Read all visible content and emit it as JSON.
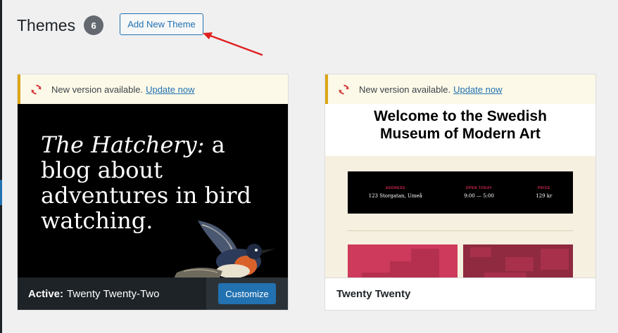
{
  "header": {
    "title": "Themes",
    "count": "6",
    "add_button": "Add New Theme"
  },
  "themes": [
    {
      "notice_text": "New version available.",
      "notice_link": "Update now",
      "screenshot_title_italic": "The Hatchery:",
      "screenshot_title_rest": " a blog about adventures in bird watching.",
      "active_prefix": "Active:",
      "name": "Twenty Twenty-Two",
      "customize_label": "Customize"
    },
    {
      "notice_text": "New version available.",
      "notice_link": "Update now",
      "screenshot_heading_line1": "Welcome to the Swedish",
      "screenshot_heading_line2": "Museum of Modern Art",
      "info": [
        {
          "label": "ADDRESS",
          "value": "123 Storgatan, Umeå"
        },
        {
          "label": "OPEN TODAY",
          "value": "9:00 — 5:00"
        },
        {
          "label": "PRICE",
          "value": "129 kr"
        }
      ],
      "name": "Twenty Twenty"
    }
  ],
  "colors": {
    "accent": "#2271b1",
    "notice_border": "#dba617",
    "update_icon": "#d63638",
    "arrow": "#e02020"
  },
  "icons": {
    "update": "update-icon",
    "arrow": "arrow-annotation-icon"
  }
}
